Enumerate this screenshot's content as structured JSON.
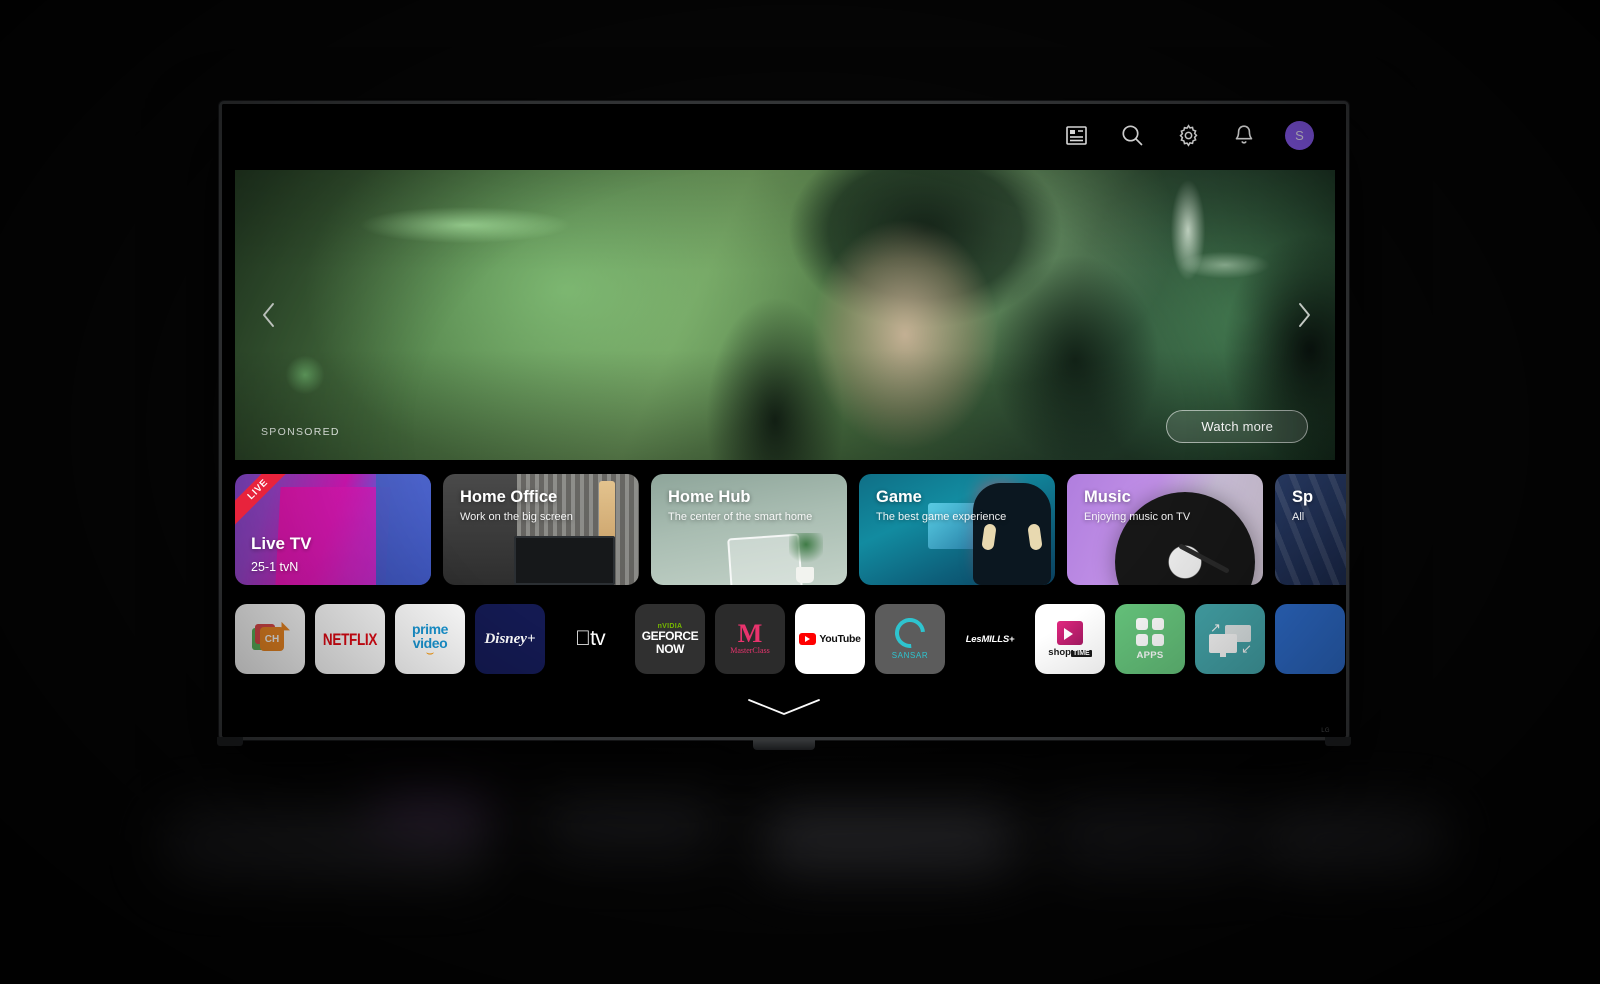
{
  "topbar": {
    "icons": [
      {
        "name": "dashboard-icon",
        "label": "Dashboard"
      },
      {
        "name": "search-icon",
        "label": "Search"
      },
      {
        "name": "gear-icon",
        "label": "Settings"
      },
      {
        "name": "bell-icon",
        "label": "Notifications"
      }
    ],
    "avatar": {
      "initial": "S",
      "color": "#8b5cf6"
    }
  },
  "hero": {
    "sponsored_label": "SPONSORED",
    "watch_more_label": "Watch more",
    "prev_label": "‹",
    "next_label": "›"
  },
  "cards": [
    {
      "id": "livetv",
      "badge": "LIVE",
      "title": "Live TV",
      "subtitle": "25-1  tvN"
    },
    {
      "id": "office",
      "title": "Home Office",
      "subtitle": "Work on the big screen"
    },
    {
      "id": "hub",
      "title": "Home Hub",
      "subtitle": "The center of the smart home"
    },
    {
      "id": "game",
      "title": "Game",
      "subtitle": "The best game experience"
    },
    {
      "id": "music",
      "title": "Music",
      "subtitle": "Enjoying music on TV"
    },
    {
      "id": "sports",
      "title": "Sp",
      "subtitle": "All"
    }
  ],
  "apps": [
    {
      "id": "ch",
      "label": "CH"
    },
    {
      "id": "netflix",
      "label": "NETFLIX"
    },
    {
      "id": "prime",
      "label_top": "prime",
      "label_bottom": "video"
    },
    {
      "id": "disney",
      "label": "Disney+"
    },
    {
      "id": "appletv",
      "label": "tv"
    },
    {
      "id": "geforcenow",
      "brand": "nVIDIA",
      "label_top": "GEFORCE",
      "label_bottom": "NOW"
    },
    {
      "id": "masterclass",
      "mark": "M",
      "label": "MasterClass"
    },
    {
      "id": "youtube",
      "label": "YouTube"
    },
    {
      "id": "sansar",
      "label": "SANSAR"
    },
    {
      "id": "lesmills",
      "label": "LesMILLS+"
    },
    {
      "id": "shoptime",
      "label": "shop",
      "label_badge": "TIME"
    },
    {
      "id": "apps",
      "label": "APPS"
    },
    {
      "id": "screenshare",
      "label": "Screen Share"
    },
    {
      "id": "more",
      "label": ""
    }
  ],
  "footer": {
    "chevron": "chevron-down-icon"
  },
  "tv": {
    "brand_mark": "LG"
  }
}
